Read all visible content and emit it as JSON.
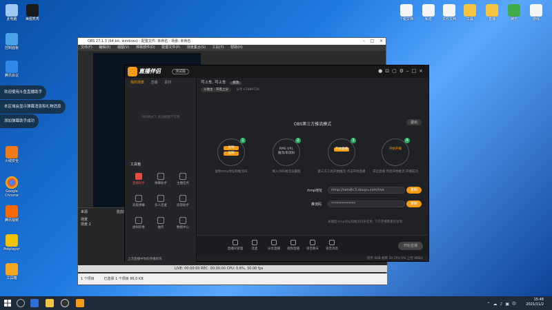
{
  "desktop": {
    "left_icons": [
      {
        "label": "此电脑",
        "color": "#9ec9f5"
      },
      {
        "label": "控制面板",
        "color": "#4aa3e8"
      },
      {
        "label": "腾讯会议",
        "color": "#2e8ae6"
      },
      {
        "label": "火绒安全",
        "color": "#f07b16"
      },
      {
        "label": "Google Chrome",
        "color": "#e8453c"
      },
      {
        "label": "腾讯视频",
        "color": "#ff6a00"
      },
      {
        "label": "Potplayer",
        "color": "#f2c200"
      },
      {
        "label": "工具箱",
        "color": "#f5a623"
      }
    ],
    "top_left_icon": {
      "label": "美图秀秀",
      "color": "#1a1a1a"
    },
    "right_icons": [
      {
        "label": "个税文档",
        "color": "#f5f5f5"
      },
      {
        "label": "私密",
        "color": "#f5f5f5"
      },
      {
        "label": "文件文档",
        "color": "#f5f5f5"
      },
      {
        "label": "工具",
        "color": "#f5c542"
      },
      {
        "label": "直播",
        "color": "#f5c542"
      },
      {
        "label": "娱乐",
        "color": "#3fae49"
      },
      {
        "label": "游戏",
        "color": "#f5f5f5"
      }
    ]
  },
  "bubbles": [
    "欢迎使用斗鱼直播助手",
    "本区域会显示弹幕消息和礼物消息",
    "添加弹幕助手成功"
  ],
  "obs": {
    "title": "OBS 27.1.3 (64-bit, windows) - 配置文件: 未命名 - 场景: 未命名",
    "menu": [
      "文件(F)",
      "编辑(E)",
      "视图(V)",
      "停靠部件(D)",
      "配置文件(P)",
      "场景集合(S)",
      "工具(T)",
      "帮助(H)"
    ],
    "dock_headers": [
      "来源",
      "混音器"
    ],
    "scenes": [
      "场景",
      "场景 2"
    ],
    "status": "LIVE: 00:00:00  REC: 00:00:00  CPU: 0.6%, 30.00 fps",
    "bottom_left": "1 个项目",
    "bottom_mid": "已选择 1 个项目  86.0 KB"
  },
  "app": {
    "logo": "直播伴侣",
    "version": "测试版",
    "left_tabs": [
      "我的场景",
      "直播",
      "素材"
    ],
    "empty_text": "OBS模式下 此功能暂不可用",
    "tools_title": "工具箱",
    "tools": [
      {
        "label": "直播助手",
        "active": true
      },
      {
        "label": "弹幕助手",
        "active": false
      },
      {
        "label": "主播任务",
        "active": false
      },
      {
        "label": "高能弹幕",
        "active": false
      },
      {
        "label": "多人连麦",
        "active": false
      },
      {
        "label": "房管助手",
        "active": false
      },
      {
        "label": "虚拟形象",
        "active": false
      },
      {
        "label": "抽奖",
        "active": false
      },
      {
        "label": "数据中心",
        "active": false
      }
    ],
    "left_footer": "上次直播中你的开播状况",
    "room_title": "可上车, 可上车",
    "room_badge": "修改",
    "category": "斗地主 - 开黑上分",
    "category_extra": "分享 67889726",
    "mode_title": "OBS第三方推流模式",
    "exit": "退出",
    "steps": [
      {
        "num": "1",
        "line1": "复制",
        "line2": "复制",
        "desc": "复制rtmp地址和推流码"
      },
      {
        "num": "2",
        "line1": "RMS URL",
        "line2": "推流/串流码",
        "desc": "填入OBS推流设置框"
      },
      {
        "num": "3",
        "line1": "开始直播",
        "line2": "",
        "desc": "第三方工具开始推流 点击开始直播"
      },
      {
        "num": "4",
        "line1": "开始开播",
        "line2": "",
        "desc": "开启直播 然后开始推流 开播成功"
      }
    ],
    "rtmp_label": "rtmp地址",
    "rtmp_value": "rtmp://sendtc3.douyu.com/live",
    "key_label": "推流码",
    "key_value": "**************",
    "copy_label": "复制",
    "hint": "关播后rtmp地址和推流码将变更, 下次开播需重新复制",
    "bottom_tools": [
      "直播间管理",
      "连麦",
      "分享直播",
      "视频直播",
      "语音聊天",
      "语音消息"
    ],
    "start_button": "开始直播",
    "stats": "内存 4GB  帧率 30  CPU 0%  上行 0KB/s"
  },
  "taskbar": {
    "date": "2021/11/2",
    "time": "15:48"
  }
}
